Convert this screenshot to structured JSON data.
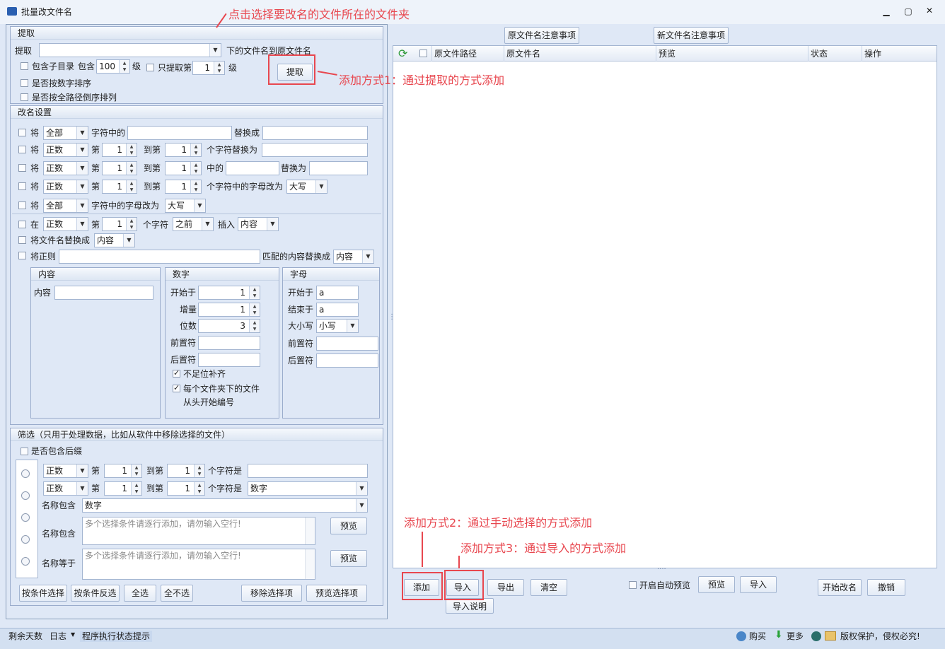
{
  "window": {
    "title": "批量改文件名"
  },
  "annotations": {
    "folder_hint": "点击选择要改名的文件所在的文件夹",
    "method1": "添加方式1：通过提取的方式添加",
    "method2": "添加方式2：通过手动选择的方式添加",
    "method3": "添加方式3：通过导入的方式添加"
  },
  "extract": {
    "header": "提取",
    "label": "提取",
    "folder_value": "",
    "suffix": "下的文件名到原文件名",
    "include_sub": "包含子目录",
    "contain": "包含",
    "levels_value": "100",
    "level": "级",
    "only_extract": "只提取第",
    "only_value": "1",
    "level2": "级",
    "button": "提取",
    "sort_numeric": "是否按数字排序",
    "sort_fullpath": "是否按全路径倒序排列"
  },
  "rename": {
    "header": "改名设置",
    "jiang": "将",
    "zai": "在",
    "row1": {
      "mode": "全部",
      "mid": "字符中的",
      "value": "",
      "replace": "替换成",
      "target": ""
    },
    "row2": {
      "mode": "正数",
      "di": "第",
      "from": "1",
      "to_label": "到第",
      "to": "1",
      "tail": "个字符替换为",
      "target": ""
    },
    "row3": {
      "mode": "正数",
      "di": "第",
      "from": "1",
      "to_label": "到第",
      "to": "1",
      "mid": "中的",
      "value": "",
      "replace": "替换为",
      "target": ""
    },
    "row4": {
      "mode": "正数",
      "di": "第",
      "from": "1",
      "to_label": "到第",
      "to": "1",
      "tail": "个字符中的字母改为",
      "case": "大写"
    },
    "row5": {
      "mode": "全部",
      "tail": "字符中的字母改为",
      "case": "大写"
    },
    "row6": {
      "mode": "正数",
      "di": "第",
      "pos": "1",
      "chars": "个字符",
      "where": "之前",
      "insert": "插入",
      "content": "内容"
    },
    "row7": {
      "label": "将文件名替换成",
      "content": "内容"
    },
    "row8": {
      "label": "将正则",
      "value": "",
      "matched": "匹配的内容替换成",
      "content": "内容"
    },
    "content_box": {
      "title": "内容",
      "label": "内容",
      "value": ""
    },
    "number_box": {
      "title": "数字",
      "start_label": "开始于",
      "start": "1",
      "step_label": "增量",
      "step": "1",
      "digits_label": "位数",
      "digits": "3",
      "prefix_label": "前置符",
      "prefix": "",
      "suffix_label": "后置符",
      "suffix": "",
      "pad": "不足位补齐",
      "restart": "每个文件夹下的文件",
      "restart2": "从头开始编号"
    },
    "letter_box": {
      "title": "字母",
      "start_label": "开始于",
      "start": "a",
      "end_label": "结束于",
      "end": "a",
      "case_label": "大小写",
      "case": "小写",
      "prefix_label": "前置符",
      "prefix": "",
      "suffix_label": "后置符",
      "suffix": ""
    }
  },
  "filter": {
    "header": "筛选（只用于处理数据，比如从软件中移除选择的文件）",
    "include_ext": "是否包含后缀",
    "r1": {
      "mode": "正数",
      "di": "第",
      "from": "1",
      "to_label": "到第",
      "to": "1",
      "is": "个字符是",
      "value": ""
    },
    "r2": {
      "mode": "正数",
      "di": "第",
      "from": "1",
      "to_label": "到第",
      "to": "1",
      "is": "个字符是",
      "value": "数字"
    },
    "r3": {
      "label": "名称包含",
      "value": "数字"
    },
    "r4": {
      "label": "名称包含",
      "placeholder": "多个选择条件请逐行添加，请勿输入空行!",
      "preview": "预览"
    },
    "r5": {
      "label": "名称等于",
      "placeholder": "多个选择条件请逐行添加，请勿输入空行!",
      "preview": "预览"
    },
    "buttons": [
      "按条件选择",
      "按条件反选",
      "全选",
      "全不选",
      "移除选择项",
      "预览选择项"
    ]
  },
  "right": {
    "old_note": "原文件名注意事项",
    "new_note": "新文件名注意事项",
    "columns": [
      "原文件路径",
      "原文件名",
      "预览",
      "状态",
      "操作"
    ],
    "add": "添加",
    "import": "导入",
    "export": "导出",
    "clear": "清空",
    "import_help": "导入说明",
    "auto_preview": "开启自动预览",
    "preview": "预览",
    "import2": "导入",
    "start": "开始改名",
    "undo": "撤销"
  },
  "status": {
    "days": "剩余天数",
    "log": "日志",
    "hint": "程序执行状态提示",
    "buy": "购买",
    "more": "更多",
    "copyright": "版权保护，侵权必究!"
  },
  "colors": {
    "accent": "#e8474f",
    "bg": "#dfe8f6"
  }
}
